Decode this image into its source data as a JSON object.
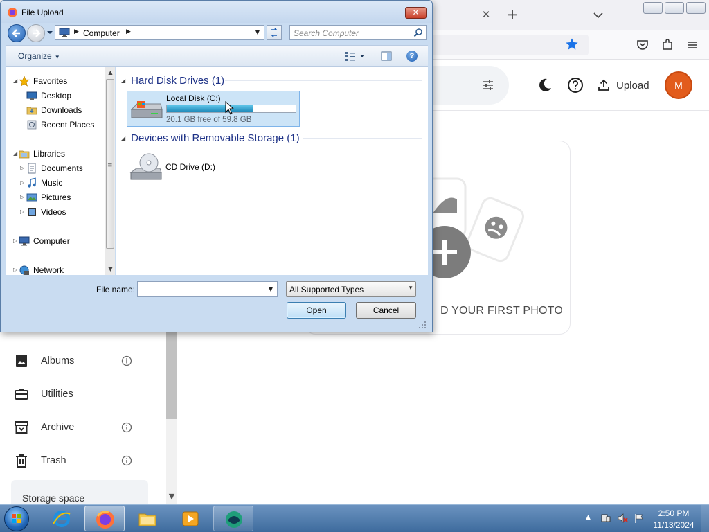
{
  "browser": {
    "toolbar_icons": [
      "close-icon",
      "plus-icon",
      "chevron-down-icon",
      "star-icon",
      "pocket-icon",
      "extensions-icon",
      "menu-icon"
    ],
    "window_controls": [
      "minimize",
      "restore",
      "close"
    ]
  },
  "app": {
    "header": {
      "upload_label": "Upload",
      "avatar_initial": "M"
    },
    "sidebar": {
      "items": [
        {
          "label": "Albums",
          "icon": "album-icon",
          "has_info": true
        },
        {
          "label": "Utilities",
          "icon": "toolbox-icon",
          "has_info": false
        },
        {
          "label": "Archive",
          "icon": "archive-icon",
          "has_info": true
        },
        {
          "label": "Trash",
          "icon": "trash-icon",
          "has_info": true
        }
      ],
      "storage_label": "Storage space"
    },
    "empty_state": {
      "text": "D YOUR FIRST PHOTO"
    },
    "colors": {
      "accent": "#e25c1c",
      "star": "#1a73e8"
    }
  },
  "dialog": {
    "title": "File Upload",
    "address": {
      "location": "Computer"
    },
    "search_placeholder": "Search Computer",
    "organize_label": "Organize",
    "nav": {
      "favorites": "Favorites",
      "desktop": "Desktop",
      "downloads": "Downloads",
      "recent": "Recent Places",
      "libraries": "Libraries",
      "documents": "Documents",
      "music": "Music",
      "pictures": "Pictures",
      "videos": "Videos",
      "computer": "Computer",
      "network": "Network"
    },
    "groups": {
      "hdd": "Hard Disk Drives (1)",
      "removable": "Devices with Removable Storage (1)"
    },
    "drives": {
      "c": {
        "name": "Local Disk (C:)",
        "free_text": "20.1 GB free of 59.8 GB",
        "used_fraction": 0.664
      },
      "d": {
        "name": "CD Drive (D:)"
      }
    },
    "file_name_label": "File name:",
    "file_name_value": "",
    "file_type": "All Supported Types",
    "open_label": "Open",
    "cancel_label": "Cancel"
  },
  "taskbar": {
    "time": "2:50 PM",
    "date": "11/13/2024",
    "apps": [
      "internet-explorer-icon",
      "firefox-icon",
      "file-explorer-icon",
      "media-player-icon",
      "app-icon"
    ]
  }
}
